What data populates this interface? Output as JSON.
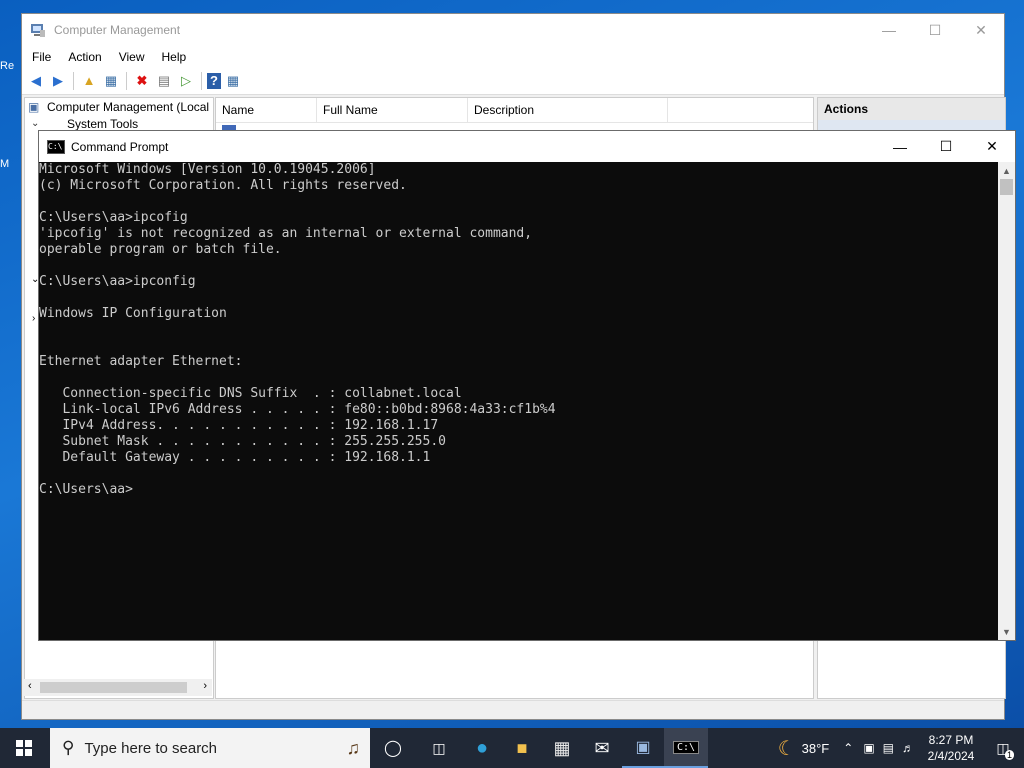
{
  "desktop": {
    "icon_labels": [
      "Re",
      "M"
    ]
  },
  "computer_management": {
    "title": "Computer Management",
    "menu": [
      "File",
      "Action",
      "View",
      "Help"
    ],
    "tree": [
      {
        "label": "Computer Management (Local"
      },
      {
        "label": "System Tools"
      }
    ],
    "columns": [
      "Name",
      "Full Name",
      "Description"
    ],
    "actions_header": "Actions"
  },
  "cmd": {
    "title": "Command Prompt",
    "lines": [
      "Microsoft Windows [Version 10.0.19045.2006]",
      "(c) Microsoft Corporation. All rights reserved.",
      "",
      "C:\\Users\\aa>ipcofig",
      "'ipcofig' is not recognized as an internal or external command,",
      "operable program or batch file.",
      "",
      "C:\\Users\\aa>ipconfig",
      "",
      "Windows IP Configuration",
      "",
      "",
      "Ethernet adapter Ethernet:",
      "",
      "   Connection-specific DNS Suffix  . : collabnet.local",
      "   Link-local IPv6 Address . . . . . : fe80::b0bd:8968:4a33:cf1b%4",
      "   IPv4 Address. . . . . . . . . . . : 192.168.1.17",
      "   Subnet Mask . . . . . . . . . . . : 255.255.255.0",
      "   Default Gateway . . . . . . . . . : 192.168.1.1",
      "",
      "C:\\Users\\aa>"
    ]
  },
  "taskbar": {
    "search_placeholder": "Type here to search",
    "weather": "38°F",
    "time": "8:27 PM",
    "date": "2/4/2024",
    "notification_count": "1"
  }
}
